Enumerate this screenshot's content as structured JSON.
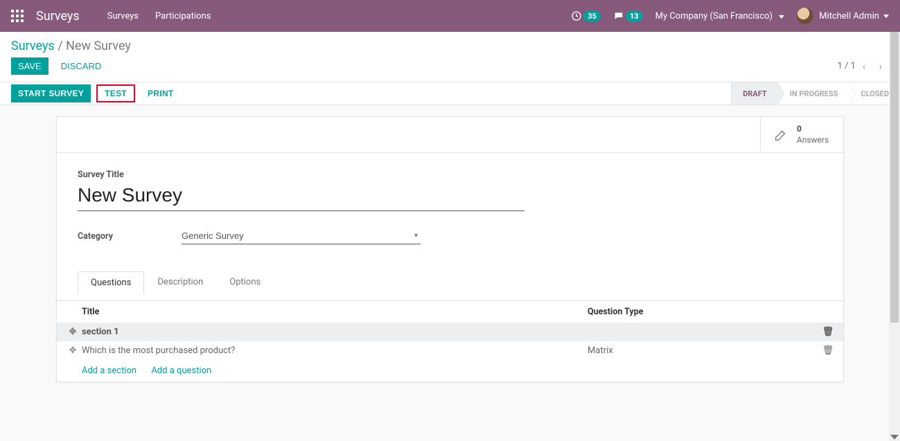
{
  "nav": {
    "brand": "Surveys",
    "links": [
      "Surveys",
      "Participations"
    ],
    "activity_count": "35",
    "messages_count": "13",
    "company": "My Company (San Francisco)",
    "user": "Mitchell Admin"
  },
  "breadcrumb": {
    "root": "Surveys",
    "current": "New Survey"
  },
  "actions": {
    "save": "SAVE",
    "discard": "DISCARD"
  },
  "pager": {
    "text": "1 / 1"
  },
  "buttons": {
    "start": "START SURVEY",
    "test": "TEST",
    "print": "PRINT"
  },
  "status": {
    "items": [
      "DRAFT",
      "IN PROGRESS",
      "CLOSED"
    ],
    "active_index": 0
  },
  "stat": {
    "value": "0",
    "label": "Answers"
  },
  "form": {
    "title_label": "Survey Title",
    "title_value": "New Survey",
    "category_label": "Category",
    "category_value": "Generic Survey"
  },
  "tabs": [
    "Questions",
    "Description",
    "Options"
  ],
  "active_tab": 0,
  "table": {
    "col_title": "Title",
    "col_type": "Question Type",
    "rows": [
      {
        "kind": "section",
        "title": "section 1",
        "type": ""
      },
      {
        "kind": "question",
        "title": "Which is the most purchased product?",
        "type": "Matrix"
      }
    ],
    "add_section": "Add a section",
    "add_question": "Add a question"
  }
}
